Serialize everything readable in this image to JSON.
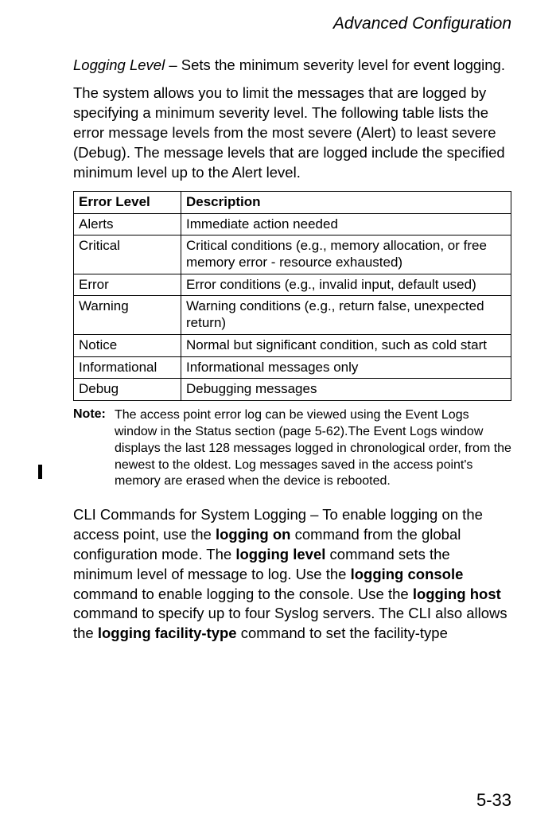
{
  "header": {
    "running_title": "Advanced Configuration"
  },
  "intro": {
    "term": "Logging Level",
    "term_rest": " – Sets the minimum severity level for event logging.",
    "body": "The system allows you to limit the messages that are logged by specifying a minimum severity level. The following table lists the error message levels from the most severe (Alert) to least severe (Debug). The message levels that are logged include the specified minimum level up to the Alert level."
  },
  "table": {
    "head_level": "Error Level",
    "head_desc": "Description",
    "rows": [
      {
        "level": "Alerts",
        "desc": "Immediate action needed"
      },
      {
        "level": "Critical",
        "desc": "Critical conditions (e.g., memory allocation, or free memory error - resource exhausted)"
      },
      {
        "level": "Error",
        "desc": "Error conditions (e.g., invalid input, default used)"
      },
      {
        "level": "Warning",
        "desc": "Warning conditions (e.g., return false, unexpected return)"
      },
      {
        "level": "Notice",
        "desc": "Normal but significant condition, such as cold start"
      },
      {
        "level": "Informational",
        "desc": "Informational messages only"
      },
      {
        "level": "Debug",
        "desc": "Debugging messages"
      }
    ]
  },
  "note": {
    "label": "Note:",
    "text": "The access point error log can be viewed using the Event Logs window in the Status section (page 5-62).The Event Logs window displays the last 128 messages logged in chronological order, from the newest to the oldest. Log messages saved in the access point's memory are erased when the device is rebooted."
  },
  "cli": {
    "p1a": "CLI Commands for System Logging – To enable logging on the access point, use the ",
    "b1": "logging on",
    "p1b": " command from the global configuration mode. The ",
    "b2": "logging level",
    "p1c": " command sets the minimum level of message to log. Use the ",
    "b3": "logging console",
    "p1d": " command to enable logging to the console. Use the ",
    "b4": "logging host",
    "p1e": " command to specify up to four Syslog servers. The CLI also allows the ",
    "b5": "logging facility-type",
    "p1f": " command to set the facility-type"
  },
  "footer": {
    "page_num": "5-33"
  }
}
